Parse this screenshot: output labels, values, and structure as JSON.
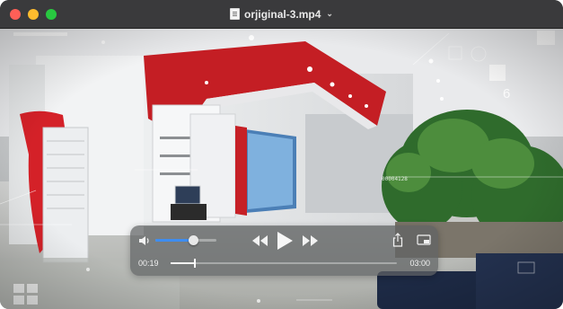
{
  "window": {
    "title": "orjiginal-3.mp4",
    "title_icon": "document-icon",
    "title_chevron": "chevron-down-icon"
  },
  "video": {
    "overlay_number": "6",
    "overlay_code": "00004128"
  },
  "controls": {
    "current_time": "00:19",
    "total_time": "03:00",
    "volume": 0.62,
    "progress": 0.106,
    "icons": {
      "volume": "volume-icon",
      "rewind": "rewind-icon",
      "play": "play-icon",
      "fast_forward": "fast-forward-icon",
      "share": "share-icon",
      "pip": "picture-in-picture-icon"
    },
    "accent_color": "#3e8df0"
  }
}
